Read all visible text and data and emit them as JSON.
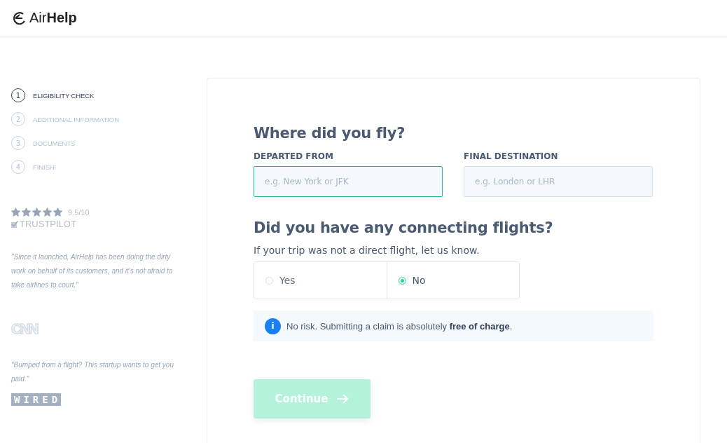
{
  "header": {
    "logo": {
      "light": "Air",
      "bold": "Help"
    }
  },
  "steps": [
    {
      "number": "1",
      "label": "ELIGIBILITY CHECK",
      "selected": true
    },
    {
      "number": "2",
      "label": "ADDITIONAL INFORMATION",
      "selected": false
    },
    {
      "number": "3",
      "label": "DOCUMENTS",
      "selected": false
    },
    {
      "number": "4",
      "label": "FINISH!",
      "selected": false
    }
  ],
  "rating": {
    "stars": 5,
    "score": "9.5/10",
    "source": "TRUSTPILOT"
  },
  "quotes": [
    {
      "text": "\"Since it launched, AirHelp has been doing the dirty work on behalf of its customers, and it's not afraid to take airlines to court.\"",
      "source": "CNN",
      "kind": "outline"
    },
    {
      "text": "\"Bumped from a flight? This startup wants to get you paid.\"",
      "source": "WIRED",
      "kind": "boxed"
    }
  ],
  "form": {
    "title": "Where did you fly?",
    "fields": [
      {
        "label": "DEPARTED FROM",
        "placeholder": "e.g. New York or JFK",
        "focused": true
      },
      {
        "label": "FINAL DESTINATION",
        "placeholder": "e.g. London or LHR",
        "focused": false
      }
    ],
    "connecting_title": "Did you have any connecting flights?",
    "connecting_hint": "If your trip was not a direct flight, let us know.",
    "options": [
      {
        "label": "Yes",
        "selected": false
      },
      {
        "label": "No",
        "selected": true
      }
    ],
    "info": "No risk. Submitting a claim is absolutely **free of charge**.",
    "info_icon": "i",
    "continue": {
      "label": "Continue",
      "disabled": true
    }
  }
}
